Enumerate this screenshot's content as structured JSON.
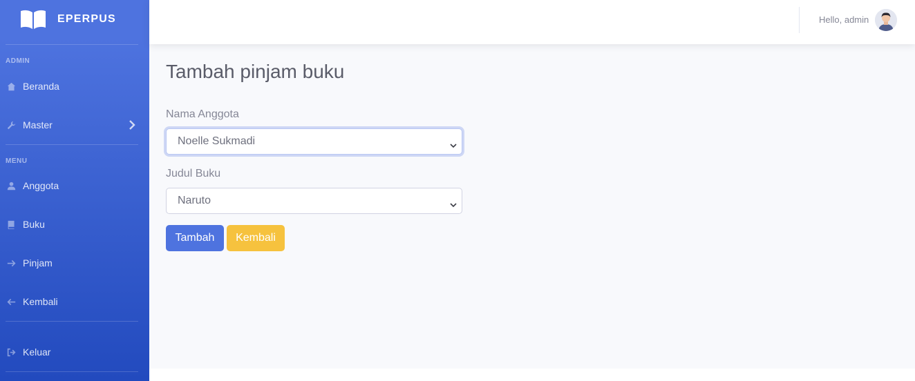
{
  "sidebar": {
    "brand": "EPERPUS",
    "headings": [
      "ADMIN",
      "MENU"
    ],
    "items": [
      {
        "label": "Beranda",
        "icon": "home-icon"
      },
      {
        "label": "Master",
        "icon": "wrench-icon"
      },
      {
        "label": "Anggota",
        "icon": "user-icon"
      },
      {
        "label": "Buku",
        "icon": "book-icon"
      },
      {
        "label": "Pinjam",
        "icon": "arrow-right-icon"
      },
      {
        "label": "Kembali",
        "icon": "arrow-left-icon"
      },
      {
        "label": "Keluar",
        "icon": "sign-out-icon"
      }
    ]
  },
  "topbar": {
    "greeting": "Hello, admin"
  },
  "main": {
    "title": "Tambah pinjam buku",
    "member_label": "Nama Anggota",
    "member_value": "Noelle Sukmadi",
    "book_label": "Judul Buku",
    "book_value": "Naruto",
    "submit_label": "Tambah",
    "back_label": "Kembali"
  },
  "colors": {
    "primary": "#4e73df",
    "warning": "#f6c23e",
    "sidebar_bottom": "#224abe",
    "content_bg": "#f8f9fc"
  }
}
